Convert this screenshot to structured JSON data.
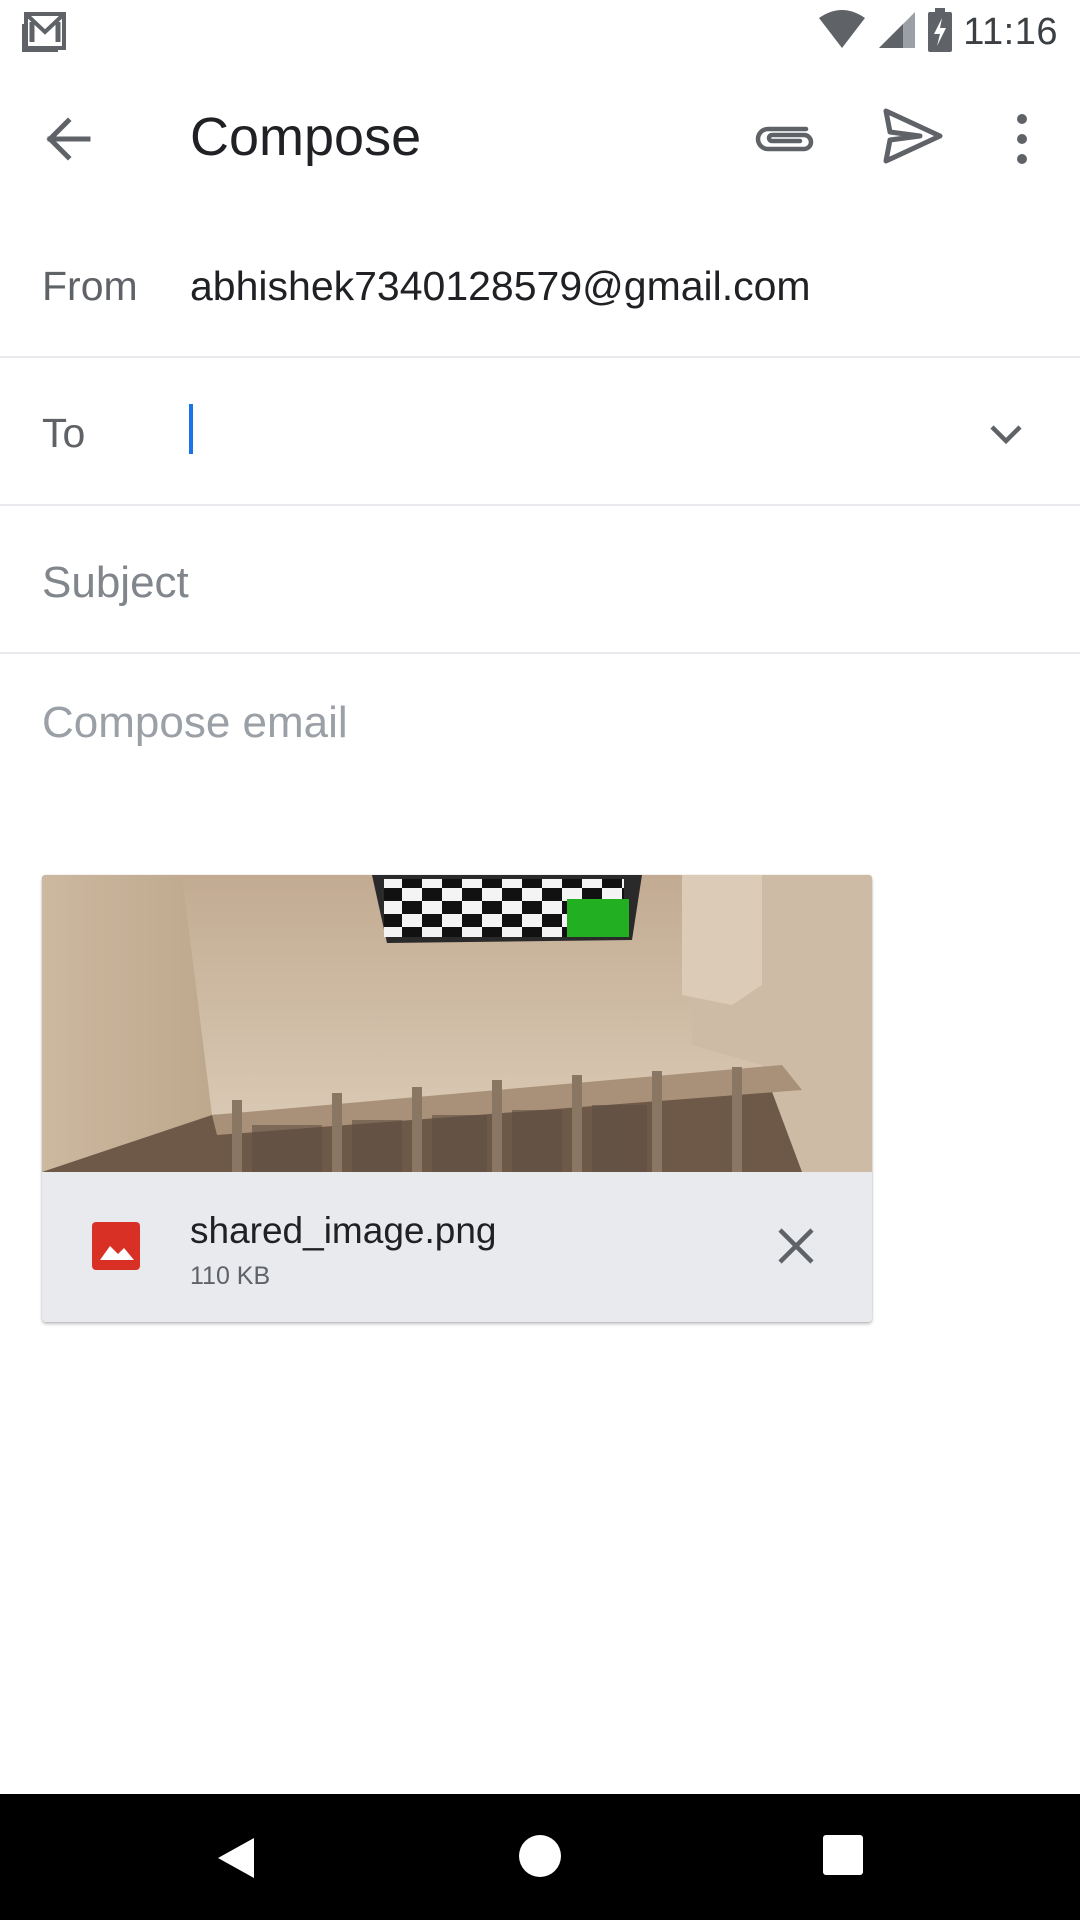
{
  "status_bar": {
    "time": "11:16",
    "icons": [
      "gmail-notification-icon",
      "wifi-icon",
      "cell-signal-icon",
      "battery-charging-icon"
    ]
  },
  "app_bar": {
    "title": "Compose",
    "icons": [
      "back-arrow-icon",
      "paperclip-icon",
      "send-icon",
      "more-vert-icon"
    ]
  },
  "form": {
    "from_label": "From",
    "from_value": "abhishek7340128579@gmail.com",
    "to_label": "To",
    "to_value": "",
    "subject_placeholder": "Subject",
    "body_placeholder": "Compose email"
  },
  "attachment": {
    "file_name": "shared_image.png",
    "file_size": "110 KB",
    "icons": [
      "image-file-icon",
      "close-icon"
    ]
  },
  "nav_bar": {
    "icons": [
      "nav-back-icon",
      "nav-home-icon",
      "nav-recents-icon"
    ]
  },
  "colors": {
    "accent": "#1a73e8",
    "image_icon_red": "#d93025",
    "attachment_footer": "#e8eaed",
    "nav_bar": "#000000"
  }
}
